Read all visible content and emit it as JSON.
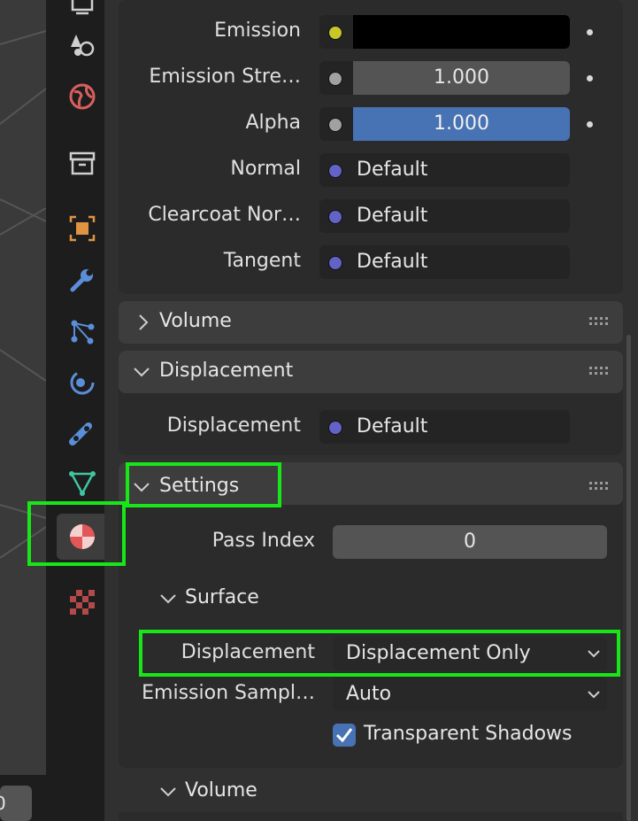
{
  "viewport": {
    "field_value": "0"
  },
  "tabs": [
    {
      "name": "output-tab",
      "icon": "printer-icon"
    },
    {
      "name": "view-layer-tab",
      "icon": "view-layer-icon"
    },
    {
      "name": "scene-tab",
      "icon": "scene-icon"
    },
    {
      "name": "world-tab",
      "icon": "world-icon"
    },
    {
      "name": "collection-tab",
      "icon": "collection-icon"
    },
    {
      "name": "object-tab",
      "icon": "object-icon"
    },
    {
      "name": "modifier-tab",
      "icon": "wrench-icon"
    },
    {
      "name": "particles-tab",
      "icon": "particles-icon"
    },
    {
      "name": "physics-tab",
      "icon": "physics-icon"
    },
    {
      "name": "constraints-tab",
      "icon": "constraint-icon"
    },
    {
      "name": "data-tab",
      "icon": "mesh-data-icon"
    },
    {
      "name": "material-tab",
      "icon": "material-icon",
      "active": true
    },
    {
      "name": "texture-tab",
      "icon": "texture-icon"
    }
  ],
  "surface_inputs": [
    {
      "label": "Emission",
      "socket_color": "#c7c729",
      "kind": "color",
      "value": "",
      "swatch": "#000000"
    },
    {
      "label": "Emission Stre…",
      "socket_color": "#a1a1a1",
      "kind": "number",
      "value": "1.000"
    },
    {
      "label": "Alpha",
      "socket_color": "#a1a1a1",
      "kind": "slider",
      "value": "1.000",
      "fill": 1.0
    },
    {
      "label": "Normal",
      "socket_color": "#6363c7",
      "kind": "link",
      "value": "Default"
    },
    {
      "label": "Clearcoat Nor…",
      "socket_color": "#6363c7",
      "kind": "link",
      "value": "Default"
    },
    {
      "label": "Tangent",
      "socket_color": "#6363c7",
      "kind": "link",
      "value": "Default"
    }
  ],
  "volume_panel": {
    "title": "Volume",
    "expanded": false
  },
  "displacement_panel": {
    "title": "Displacement",
    "expanded": true,
    "row": {
      "label": "Displacement",
      "value": "Default",
      "socket_color": "#6363c7"
    }
  },
  "settings_panel": {
    "title": "Settings",
    "expanded": true,
    "pass_index": {
      "label": "Pass Index",
      "value": "0"
    },
    "surface_sub": {
      "title": "Surface",
      "displacement": {
        "label": "Displacement",
        "value": "Displacement Only"
      },
      "emission_sampling": {
        "label": "Emission Sampl…",
        "value": "Auto"
      },
      "transparent_shadows": {
        "label": "Transparent Shadows",
        "checked": true
      }
    },
    "volume_sub": {
      "title": "Volume"
    }
  },
  "colors": {
    "accent": "#4772b3",
    "highlight": "#19e619",
    "material_icon": "#e25858"
  }
}
